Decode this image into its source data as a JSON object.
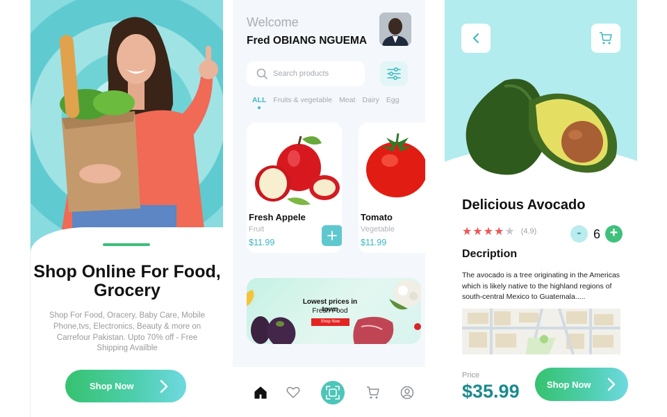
{
  "onboarding": {
    "title": "Shop Online For Food, Grocery",
    "description": "Shop For Food, Oracery, Baby Care, Mobile Phone,tvs, Electronics, Beauty & more on Carrefour Pakistan. Upto 70% off - Free Shipping Availble",
    "cta_label": "Shop Now"
  },
  "home": {
    "greeting": "Welcome",
    "user_name": "Fred OBIANG NGUEMA",
    "search_placeholder": "Search products",
    "categories": [
      "ALL",
      "Fruits & vegetable",
      "Meat",
      "Dairy",
      "Egg"
    ],
    "products": [
      {
        "name": "Fresh Appele",
        "category": "Fruit",
        "price": "$11.99"
      },
      {
        "name": "Tomato",
        "category": "Vegetable",
        "price": "$11.99"
      }
    ],
    "banner": {
      "title": "Lowest prices in town",
      "subtitle": "Fresh Food",
      "cta": "Shop Now"
    },
    "nav_items": [
      "home-icon",
      "heart-icon",
      "scan-icon",
      "cart-icon",
      "profile-icon"
    ]
  },
  "detail": {
    "title": "Delicious Avocado",
    "rating_stars": 4,
    "rating": "(4.9)",
    "quantity": "6",
    "qty_minus": "-",
    "qty_plus": "+",
    "description_heading": "Decription",
    "description": "The avocado is a tree originating in the Americas which is likely native to the highland regions of south-central Mexico to Guatemala.....",
    "price_label": "Price",
    "price": "$35.99",
    "cta_label": "Shop Now"
  },
  "colors": {
    "accent_teal": "#38b6c2",
    "accent_green": "#36c26f",
    "star_red": "#ec5757",
    "price_teal": "#1b8a8d"
  }
}
